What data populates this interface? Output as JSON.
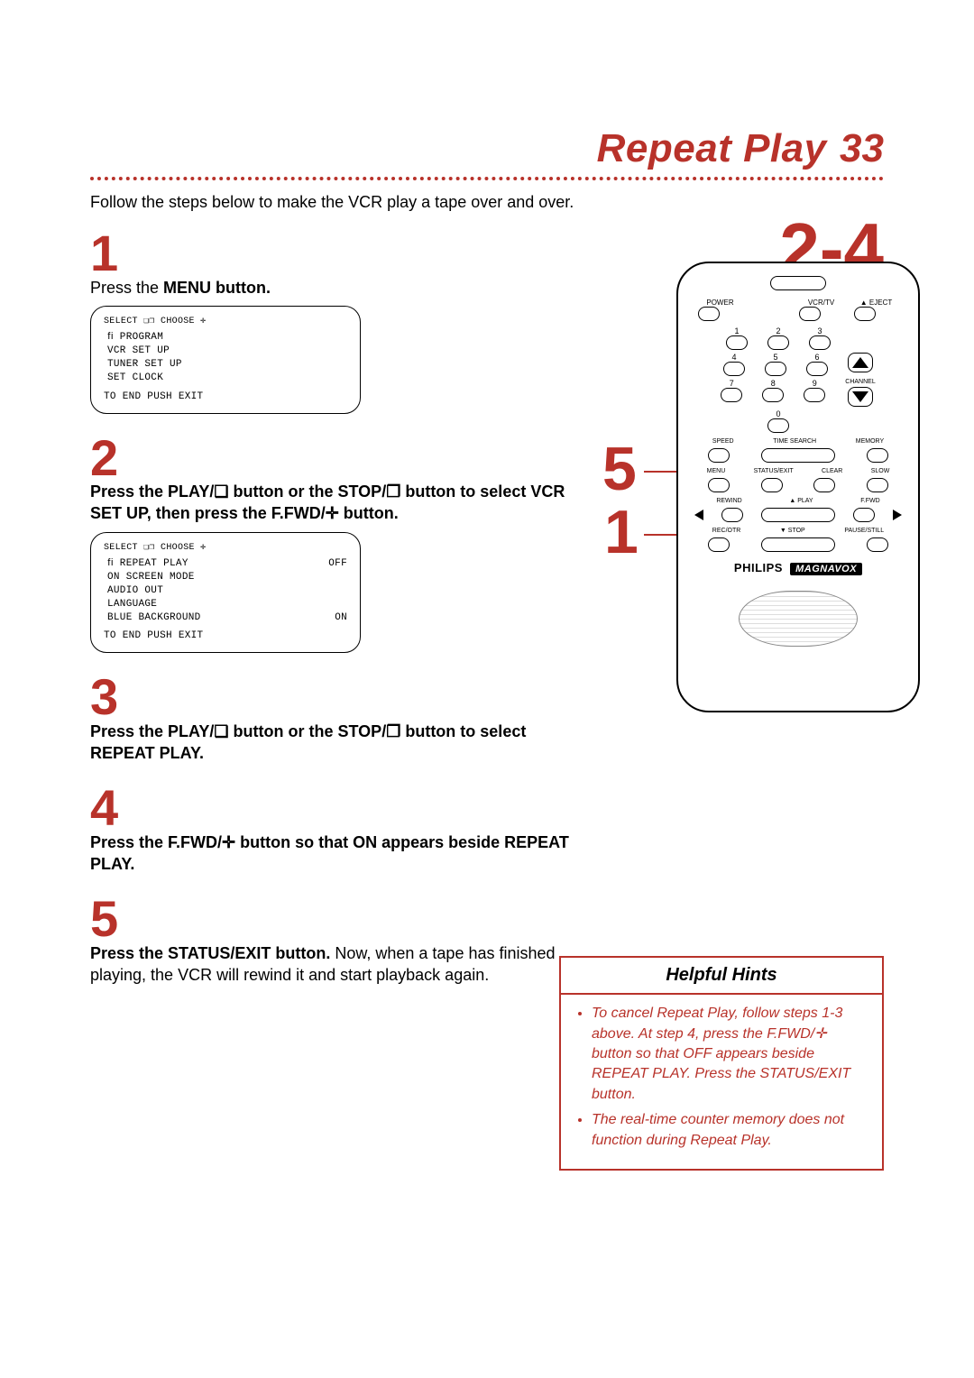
{
  "header": {
    "title": "Repeat Play",
    "page_number": "33"
  },
  "intro": "Follow the steps below to make the VCR play a tape over and over.",
  "steps": {
    "s1": {
      "num": "1",
      "text_prefix": "Press the ",
      "text_bold": "MENU button.",
      "text_suffix": ""
    },
    "s2": {
      "num": "2",
      "text": "Press the PLAY/❏ button or the STOP/❐ button to select VCR SET UP, then press the F.FWD/✛ button."
    },
    "s3": {
      "num": "3",
      "text": "Press the PLAY/❏ button or the STOP/❐ button to select REPEAT PLAY."
    },
    "s4": {
      "num": "4",
      "text": "Press the F.FWD/✛ button so that ON appears beside REPEAT PLAY."
    },
    "s5": {
      "num": "5",
      "bold": "Press the STATUS/EXIT button.",
      "rest": " Now, when a tape has finished playing, the VCR will rewind it and start playback again."
    }
  },
  "screens": {
    "menu1": {
      "header": "SELECT ❏❐  CHOOSE ✛",
      "items": [
        "ﬁ  PROGRAM",
        "   VCR SET UP",
        "   TUNER SET UP",
        "   SET CLOCK"
      ],
      "footer": "TO END PUSH EXIT"
    },
    "menu2": {
      "header": "SELECT ❏❐  CHOOSE ✛",
      "rows": [
        {
          "l": "ﬁ  REPEAT PLAY",
          "r": "OFF"
        },
        {
          "l": "   ON SCREEN MODE",
          "r": ""
        },
        {
          "l": "   AUDIO OUT",
          "r": ""
        },
        {
          "l": "   LANGUAGE",
          "r": ""
        },
        {
          "l": "   BLUE BACKGROUND",
          "r": "ON"
        }
      ],
      "footer": "TO END PUSH EXIT"
    }
  },
  "callouts": {
    "big24": "2-4",
    "big5": "5",
    "big1": "1"
  },
  "remote": {
    "top_labels": {
      "power": "POWER",
      "vcrtv": "VCR/TV",
      "eject": "▲ EJECT"
    },
    "digits": [
      "1",
      "2",
      "3",
      "4",
      "5",
      "6",
      "7",
      "8",
      "9",
      "0"
    ],
    "channel": "CHANNEL",
    "row4": {
      "speed": "SPEED",
      "tsearch": "TIME SEARCH",
      "memory": "MEMORY"
    },
    "row5": {
      "menu": "MENU",
      "status": "STATUS/EXIT",
      "clear": "CLEAR",
      "slow": "SLOW"
    },
    "row6": {
      "rewind": "REWIND",
      "play": "▲ PLAY",
      "ffwd": "F.FWD"
    },
    "row7": {
      "rec": "REC/OTR",
      "stop": "▼ STOP",
      "pause": "PAUSE/STILL"
    },
    "brand": "PHILIPS",
    "brand_badge": "MAGNAVOX"
  },
  "hints": {
    "title": "Helpful Hints",
    "items": [
      "To cancel Repeat Play, follow steps 1-3 above. At step 4, press the F.FWD/✛ button so that OFF appears beside REPEAT PLAY. Press the STATUS/EXIT button.",
      "The real-time counter memory does not function during Repeat Play."
    ]
  }
}
